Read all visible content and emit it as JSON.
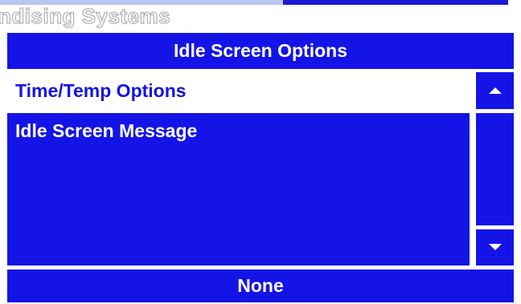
{
  "brand": {
    "text": "ndising Systems"
  },
  "header": {
    "title": "Idle Screen Options"
  },
  "menu": {
    "items": [
      {
        "label": "Time/Temp Options",
        "selected": false
      },
      {
        "label": "Idle Screen Message",
        "selected": true
      }
    ]
  },
  "scroll": {
    "up_icon": "triangle-up",
    "down_icon": "triangle-down"
  },
  "footer": {
    "value": "None"
  },
  "colors": {
    "accent_blue": "#1414e6",
    "background": "#ffffff",
    "text_on_accent": "#ffffff",
    "brand_outline": "#b4b4b4"
  }
}
